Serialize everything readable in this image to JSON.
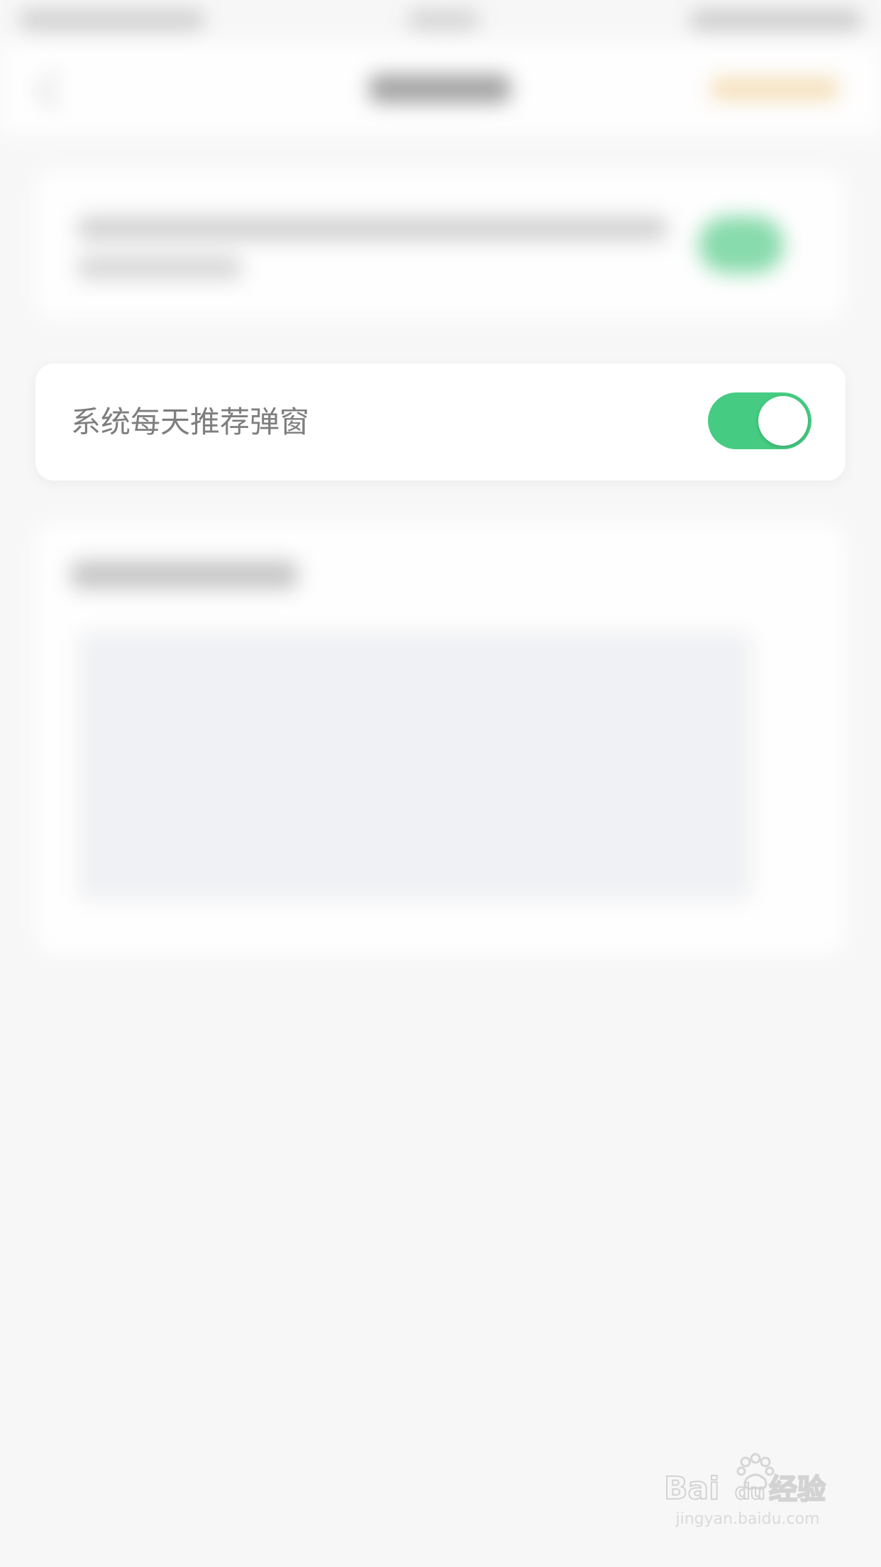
{
  "settings": {
    "daily_popup_label": "系统每天推荐弹窗",
    "daily_popup_enabled": true
  },
  "colors": {
    "toggle_on": "#45cc82",
    "label_text": "#7e7e7e",
    "background": "#f7f7f7",
    "card": "#ffffff"
  },
  "watermark": {
    "brand": "Baidu经验",
    "url": "jingyan.baidu.com"
  }
}
